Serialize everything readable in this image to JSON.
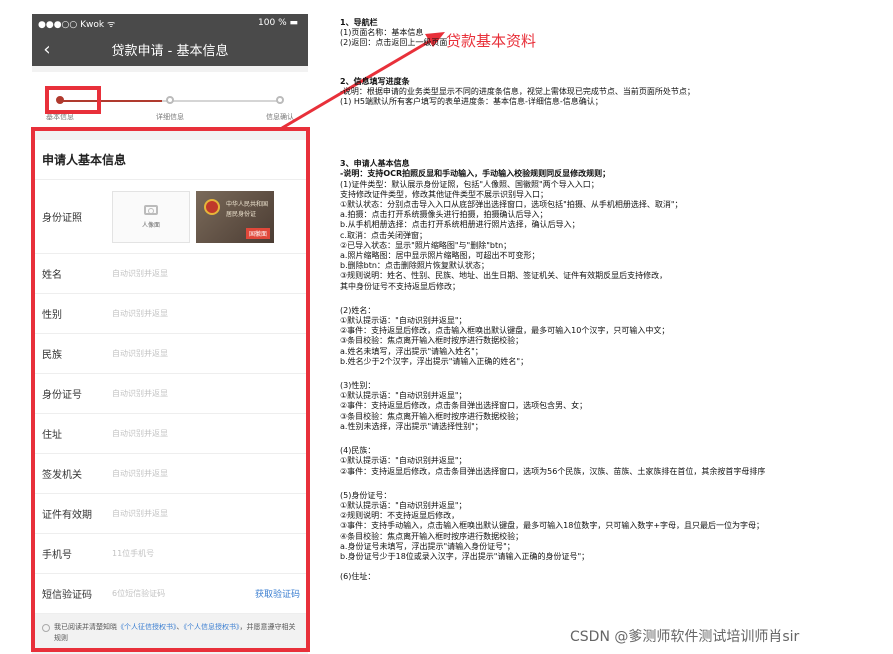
{
  "phone": {
    "status_left": "●●●○○ Kwok ᯤ",
    "status_right": "100 % ▬",
    "nav_back": "‹",
    "nav_title": "贷款申请 - 基本信息",
    "progress": {
      "steps": [
        "基本信息",
        "详细信息",
        "信息确认"
      ],
      "current_step": 1
    },
    "section_title": "申请人基本信息",
    "id_row": {
      "label": "身份证照",
      "front_caption": "人像面",
      "back_title": "中华人民共和国",
      "back_sub": "居民身份证",
      "back_caption": "国徽面"
    },
    "fields": [
      {
        "label": "姓名",
        "placeholder": "自动识别并返显"
      },
      {
        "label": "性别",
        "placeholder": "自动识别并返显"
      },
      {
        "label": "民族",
        "placeholder": "自动识别并返显"
      },
      {
        "label": "身份证号",
        "placeholder": "自动识别并返显"
      },
      {
        "label": "住址",
        "placeholder": "自动识别并返显"
      },
      {
        "label": "签发机关",
        "placeholder": "自动识别并返显"
      },
      {
        "label": "证件有效期",
        "placeholder": "自动识别并返显"
      },
      {
        "label": "手机号",
        "placeholder": "11位手机号"
      }
    ],
    "sms": {
      "label": "短信验证码",
      "placeholder": "6位短信验证码",
      "button": "获取验证码"
    },
    "agreement": {
      "pre": "我已阅读并清楚知晓",
      "link1": "《个人征信授权书》",
      "mid": "、",
      "link2": "《个人信息授权书》",
      "post": "，并愿意遵守相关规则"
    }
  },
  "annotation": {
    "label": "贷款基本资料"
  },
  "notes": {
    "s1": [
      "1、导航栏",
      "(1)页面名称：基本信息",
      "(2)返回：点击返回上一级页面"
    ],
    "s2": [
      "2、信息填写进度条",
      "-说明：根据申请的业务类型显示不同的进度条信息，视觉上需体现已完成节点、当前页面所处节点；",
      "(1) H5端默认所有客户填写的表单进度条：基本信息-详细信息-信息确认；"
    ],
    "s3_title": "3、申请人基本信息",
    "s3_desc": "-说明：支持OCR拍照反显和手动输入，手动输入校验规则同反显修改规则；",
    "s3": [
      "(1)证件类型：默认展示身份证照，包括\"人像照、国徽照\"两个导入入口；",
      "    支持修改证件类型，修改其他证件类型不展示识别导入口；",
      "    ①默认状态：分别点击导入入口从底部弹出选择窗口，选项包括\"拍摄、从手机相册选择、取消\"；",
      "        a.拍摄：点击打开系统摄像头进行拍摄，拍摄确认后导入；",
      "        b.从手机相册选择：点击打开系统相册进行照片选择，确认后导入；",
      "        c.取消：点击关闭弹窗；",
      "    ②已导入状态：显示\"照片缩略图\"与\"删除\"btn；",
      "        a.照片缩略图：居中显示照片缩略图，可超出不可变形；",
      "        b.删除btn：点击删除照片恢复默认状态；",
      "    ③规则说明：姓名、性别、民族、地址、出生日期、签证机关、证件有效期反显后支持修改，",
      "        其中身份证号不支持返显后修改；"
    ],
    "s4": [
      "(2)姓名：",
      "    ①默认提示语：\"自动识别并返显\"；",
      "    ②事件：支持返显后修改，点击输入框唤出默认键盘，最多可输入10个汉字，只可输入中文；",
      "    ③条目校验：焦点离开输入框时按序进行数据校验；",
      "        a.姓名未填写，浮出提示\"请输入姓名\"；",
      "        b.姓名少于2个汉字，浮出提示\"请输入正确的姓名\"；"
    ],
    "s5": [
      "(3)性别：",
      "    ①默认提示语：\"自动识别并返显\"；",
      "    ②事件：支持返显后修改，点击条目弹出选择窗口，选项包含男、女；",
      "    ③条目校验：焦点离开输入框时按序进行数据校验；",
      "        a.性别未选择，浮出提示\"请选择性别\"；"
    ],
    "s6": [
      "(4)民族：",
      "    ①默认提示语：\"自动识别并返显\"；",
      "    ②事件：支持返显后修改，点击条目弹出选择窗口，选项为56个民族，汉族、苗族、土家族排在首位，其余按首字母排序"
    ],
    "s7": [
      "(5)身份证号：",
      "    ①默认提示语：\"自动识别并返显\"；",
      "    ②规则说明：不支持返显后修改，",
      "    ③事件：支持手动输入，点击输入框唤出默认键盘，最多可输入18位数字，只可输入数字+字母，且只最后一位为字母；",
      "    ④条目校验：焦点离开输入框时按序进行数据校验；",
      "        a.身份证号未填写，浮出提示\"请输入身份证号\"；",
      "        b.身份证号少于18位或录入汉字，浮出提示\"请输入正确的身份证号\"；"
    ],
    "s8": "(6)住址："
  },
  "watermark": "CSDN @爹测师软件测试培训师肖sir",
  "colors": {
    "annotation_red": "#e8303a",
    "nav_bg": "#4a4a4a",
    "link_blue": "#3c7fd1"
  }
}
